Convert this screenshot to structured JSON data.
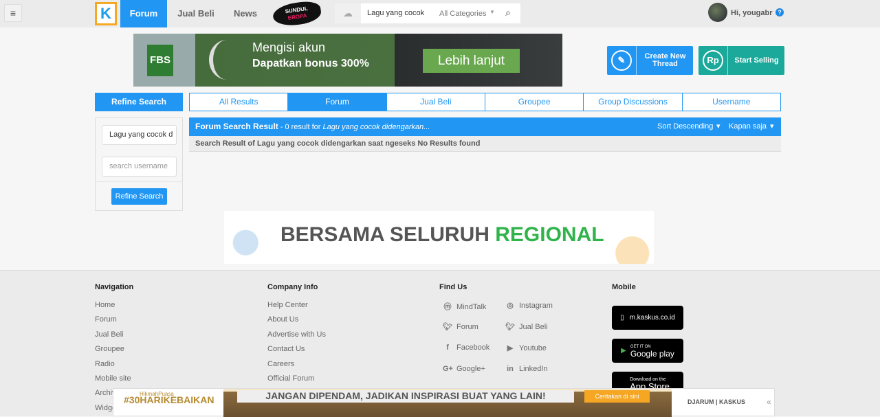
{
  "header": {
    "menu_icon": "hamburger-icon",
    "logo_text": "K",
    "nav": [
      "Forum",
      "Jual Beli",
      "News"
    ],
    "active_nav": "Forum",
    "sundul_logo": [
      "SUNDUL",
      "EROPA"
    ],
    "search_query": "Lagu yang cocok d",
    "search_category": "All Categories",
    "user_greeting": "Hi, yougabr",
    "help_icon": "?"
  },
  "ad_top": {
    "brand": "FBS",
    "line1": "Mengisi akun",
    "line2": "Dapatkan bonus 300%",
    "cta": "Lebih lanjut"
  },
  "actions": {
    "create_thread": "Create New Thread",
    "start_selling": "Start Selling",
    "create_icon": "pencil-icon",
    "sell_icon": "Rp"
  },
  "sidebar": {
    "title": "Refine Search",
    "query_value": "Lagu yang cocok d",
    "username_placeholder": "search username",
    "button": "Refine Search"
  },
  "tabs": {
    "items": [
      "All Results",
      "Forum",
      "Jual Beli",
      "Groupee",
      "Group Discussions",
      "Username"
    ],
    "active": "Forum"
  },
  "results": {
    "title": "Forum Search Result",
    "count_text": " - 0 result for ",
    "query_italic": "Lagu yang cocok didengarkan...",
    "sort": "Sort Descending",
    "time": "Kapan saja",
    "message": "Search Result of Lagu yang cocok didengarkan saat ngeseks No Results found"
  },
  "ad_mid": {
    "text1": "BERSAMA SELURUH ",
    "text2": "REGIONAL"
  },
  "footer": {
    "navigation": {
      "title": "Navigation",
      "items": [
        "Home",
        "Forum",
        "Jual Beli",
        "Groupee",
        "Radio",
        "Mobile site",
        "Archive",
        "Widget"
      ]
    },
    "company": {
      "title": "Company Info",
      "items": [
        "Help Center",
        "About Us",
        "Advertise with Us",
        "Contact Us",
        "Careers",
        "Official Forum"
      ]
    },
    "find_us": {
      "title": "Find Us",
      "left": [
        "MindTalk",
        "Forum",
        "Facebook",
        "Google+"
      ],
      "right": [
        "Instagram",
        "Jual Beli",
        "Youtube",
        "LinkedIn"
      ]
    },
    "mobile": {
      "title": "Mobile",
      "badges": [
        "m.kaskus.co.id",
        "Google play",
        "App Store"
      ],
      "badge_small": [
        "",
        "GET IT ON",
        "Download on the"
      ]
    }
  },
  "ad_bottom": {
    "small": "HikmahPuasa",
    "tag": "#30HARIKEBAIKAN",
    "banner": "JANGAN DIPENDAM, JADIKAN INSPIRASI BUAT YANG LAIN!",
    "cta": "Ceritakan di sini",
    "brand": "DJARUM | KASKUS",
    "arrow": "«"
  },
  "colors": {
    "primary": "#2196f3",
    "teal": "#1aa99a",
    "header_bg": "#ebebeb"
  }
}
